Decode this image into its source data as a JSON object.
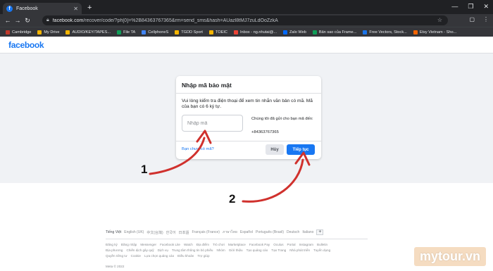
{
  "browser": {
    "tab_title": "Facebook",
    "tab_close": "✕",
    "new_tab": "+",
    "window_controls": [
      "—",
      "❐",
      "✕"
    ],
    "url_host": "facebook.com",
    "url_path": "/recover/code/?ph[0]=%2B84363767365&rm=send_sms&hash=AUazl8tMJ7zuLdOoZzkA",
    "bookmarks": [
      {
        "label": "Cambridge",
        "color": "#c0392b"
      },
      {
        "label": "My Drive",
        "color": "#f4b400"
      },
      {
        "label": "AUDIO/KEY/TAPES...",
        "color": "#f4b400"
      },
      {
        "label": "File TA",
        "color": "#0f9d58"
      },
      {
        "label": "CellphoneS",
        "color": "#4285f4"
      },
      {
        "label": "TGDD Sport",
        "color": "#f4b400"
      },
      {
        "label": "TOEIC",
        "color": "#f4b400"
      },
      {
        "label": "Inbox - ng.nhutai@...",
        "color": "#ea4335"
      },
      {
        "label": "Zalo Web",
        "color": "#0068ff"
      },
      {
        "label": "Bản sao của Frame...",
        "color": "#0f9d58"
      },
      {
        "label": "Free Vectors, Stock...",
        "color": "#1a73e8"
      },
      {
        "label": "Etsy Vietnam - Sho...",
        "color": "#f56400"
      }
    ]
  },
  "fb": {
    "logo": "facebook",
    "accent": "#1877f2"
  },
  "card": {
    "title": "Nhập mã bảo mật",
    "description": "Vui lòng kiểm tra điện thoại để xem tin nhắn văn bản có mã. Mã của bạn có 6 ký tự.",
    "input_placeholder": "Nhập mã",
    "sent_text": "Chúng tôi đã gửi cho bạn mã đến:",
    "phone": "+84363767365",
    "no_code_link": "Bạn chưa có mã?",
    "cancel_label": "Hủy",
    "continue_label": "Tiếp tục"
  },
  "footer": {
    "languages": [
      "Tiếng Việt",
      "English (UK)",
      "中文(台灣)",
      "한국어",
      "日本語",
      "Français (France)",
      "ภาษาไทย",
      "Español",
      "Português (Brasil)",
      "Deutsch",
      "Italiano"
    ],
    "add_language": "+",
    "links_row1": [
      "Đăng ký",
      "Đăng nhập",
      "Messenger",
      "Facebook Lite",
      "Watch",
      "Địa điểm",
      "Trò chơi",
      "Marketplace",
      "Facebook Pay",
      "Oculus",
      "Portal",
      "Instagram",
      "Bulletin"
    ],
    "links_row2": [
      "Địa phương",
      "Chiến dịch gây quỹ",
      "Dịch vụ",
      "Trung tâm thông tin bỏ phiếu",
      "Nhóm",
      "Giới thiệu",
      "Tạo quảng cáo",
      "Tạo Trang",
      "Nhà phát triển",
      "Tuyển dụng"
    ],
    "links_row3": [
      "Quyền riêng tư",
      "Cookie",
      "Lựa chọn quảng cáo",
      "Điều khoản",
      "Trợ giúp"
    ],
    "copyright": "Meta © 2022"
  },
  "annotations": {
    "step1": "1",
    "step2": "2"
  },
  "watermark": "mytour.vn"
}
